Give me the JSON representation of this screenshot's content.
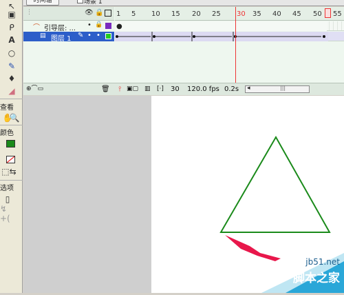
{
  "toolbar": {
    "scene_tab": "时间轴",
    "scene_label": "场景 1"
  },
  "tools_panel": {
    "view_label": "查看",
    "color_label": "颜色",
    "options_label": "选项",
    "icons": [
      "pointer-icon",
      "subselect-icon",
      "lasso-icon",
      "text-icon",
      "oval-icon",
      "pencil-icon",
      "ink-bottle-icon",
      "eraser-icon",
      "hand-icon",
      "zoom-icon",
      "stroke-color-icon",
      "fill-color-icon",
      "swap-colors-icon"
    ]
  },
  "timeline": {
    "frame_numbers": [
      "1",
      "5",
      "10",
      "15",
      "20",
      "25",
      "30",
      "35",
      "40",
      "45",
      "50",
      "55"
    ],
    "layers": [
      {
        "name": "引导层: ...",
        "type": "guide"
      },
      {
        "name": "图层 1",
        "type": "normal",
        "selected": true
      }
    ],
    "current_frame": "30",
    "fps": "120.0 fps",
    "time": "0.2s"
  },
  "watermark": {
    "site": "jb51.net",
    "brand": "脚本之家"
  },
  "colors": {
    "triangle_stroke": "#1a8a1a",
    "arrow_fill": "#e8174b",
    "selected_layer": "#2c5ec9",
    "playhead": "#e33333"
  }
}
